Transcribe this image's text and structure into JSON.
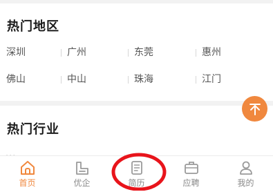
{
  "hot_regions": {
    "title": "热门地区",
    "items": [
      {
        "label": "深圳"
      },
      {
        "label": "广州"
      },
      {
        "label": "东莞"
      },
      {
        "label": "惠州"
      },
      {
        "label": "佛山"
      },
      {
        "label": "中山"
      },
      {
        "label": "珠海"
      },
      {
        "label": "江门"
      }
    ]
  },
  "hot_industries": {
    "title": "热门行业",
    "partial_row_left": "...",
    "partial_row_right": "..."
  },
  "tabbar": {
    "items": [
      {
        "label": "首页",
        "icon": "home-icon",
        "active": true
      },
      {
        "label": "优企",
        "icon": "company-icon",
        "active": false
      },
      {
        "label": "简历",
        "icon": "resume-icon",
        "active": false
      },
      {
        "label": "应聘",
        "icon": "briefcase-icon",
        "active": false
      },
      {
        "label": "我的",
        "icon": "user-icon",
        "active": false
      }
    ]
  },
  "colors": {
    "accent": "#f0883e",
    "annotation": "#e8141b"
  }
}
